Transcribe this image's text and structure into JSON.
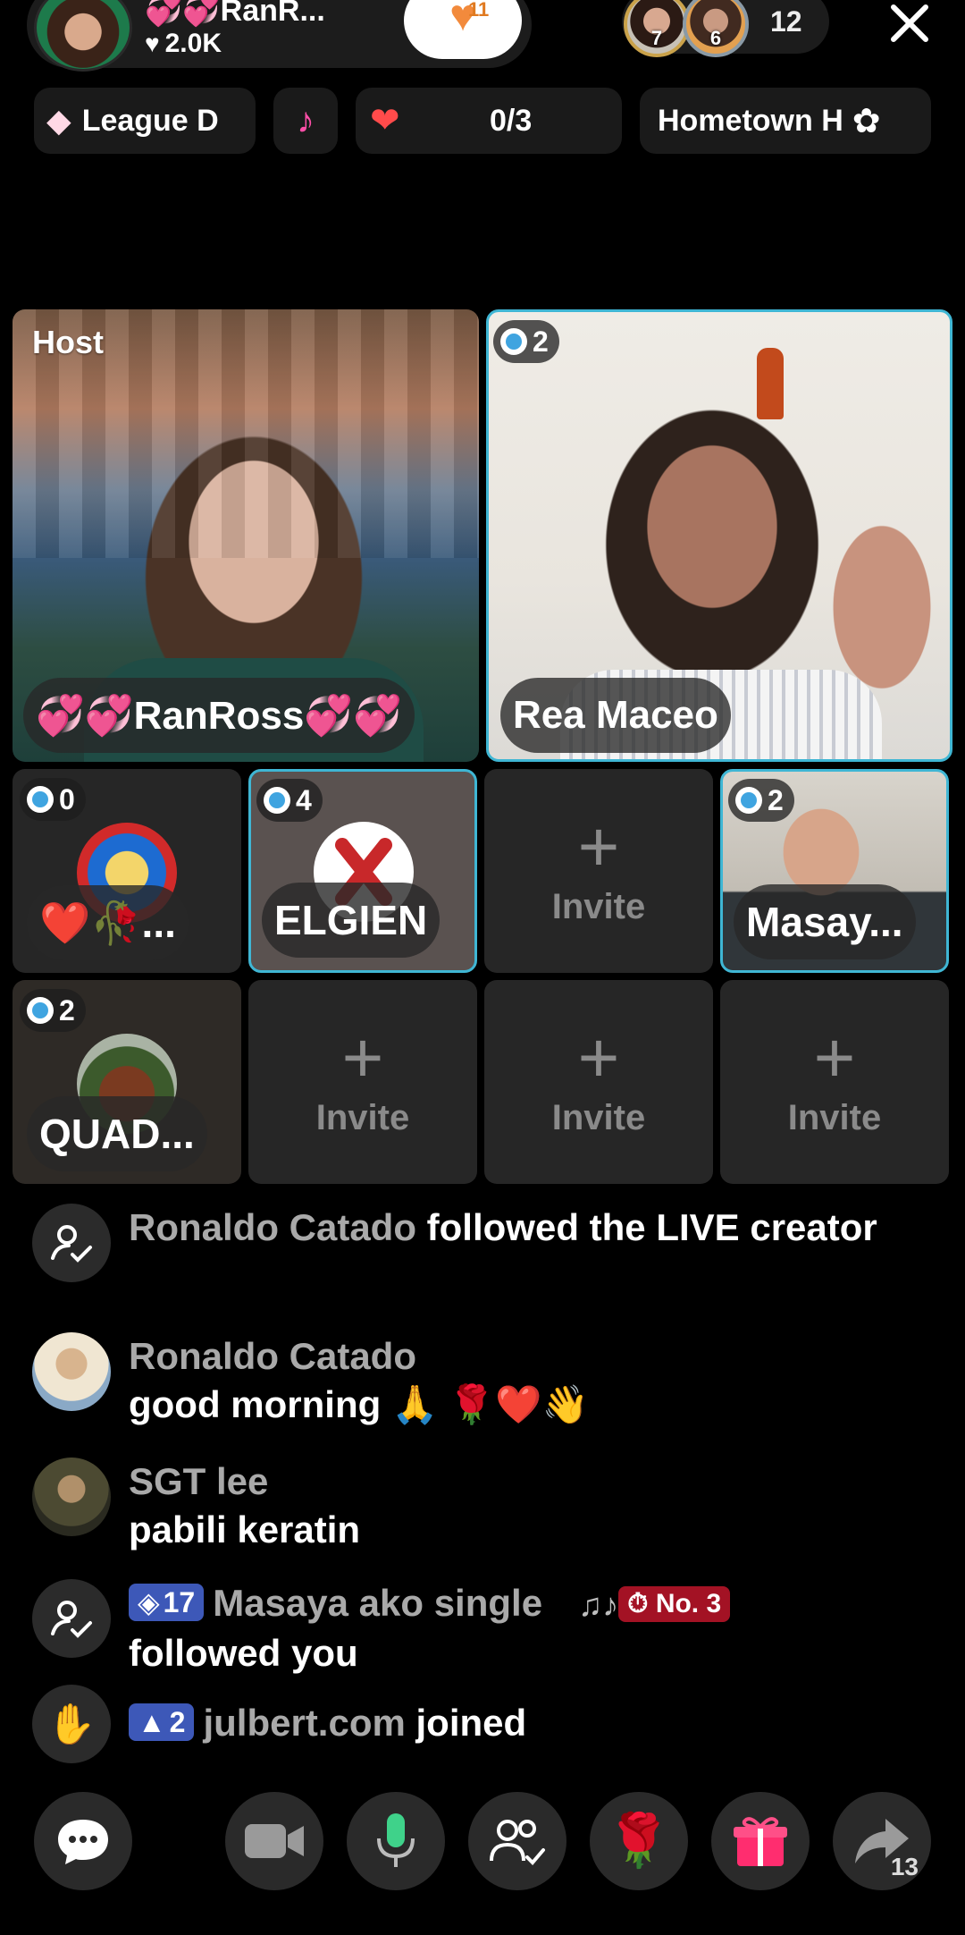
{
  "header": {
    "host_name": "💞💞RanR...",
    "host_likes": "2.0K",
    "follow_count": "11",
    "viewer_badges": [
      "7",
      "6"
    ],
    "viewer_count": "12"
  },
  "chips": {
    "league": "League D",
    "goal_value": "0/3",
    "hometown": "Hometown H"
  },
  "tiles": {
    "host_label": "Host",
    "host_name": "💞💞RanRoss💞💞",
    "guest_name": "Rea Maceo",
    "guest_badge": "2",
    "seat1": {
      "badge": "0",
      "name": "❤️🥀..."
    },
    "seat2": {
      "badge": "4",
      "name": "ELGIEN"
    },
    "seat4": {
      "badge": "2",
      "name": "Masay..."
    },
    "seat5": {
      "badge": "2",
      "name": "QUAD..."
    },
    "invite_label": "Invite",
    "invite_plus": "+"
  },
  "comments": [
    {
      "user": "Ronaldo Catado",
      "msg": " followed the LIVE creator"
    },
    {
      "user": "Ronaldo Catado",
      "msg": "good morning 🙏 🌹❤️👋"
    },
    {
      "user": "SGT lee",
      "msg": "pabili keratin"
    },
    {
      "level": "17",
      "user": "Masaya ako single",
      "note": "♫♪",
      "rank": "No. 3",
      "msg": "followed you"
    },
    {
      "level": "2",
      "user": "julbert.com",
      "msg": " joined"
    }
  ],
  "bottom": {
    "share_count": "13"
  },
  "colors": {
    "accent_cyan": "#3fb6d4",
    "badge_blue": "#3d58b8",
    "rank_red": "#a31224",
    "gift_pink": "#ff2d6f"
  }
}
